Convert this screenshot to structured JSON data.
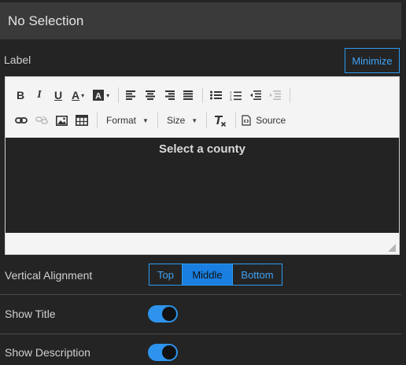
{
  "selection": {
    "text": "No Selection"
  },
  "label_section": {
    "label": "Label",
    "minimize_label": "Minimize"
  },
  "editor": {
    "toolbar": {
      "format_label": "Format",
      "size_label": "Size",
      "source_label": "Source"
    },
    "content": "Select a county"
  },
  "vertical_alignment": {
    "label": "Vertical Alignment",
    "options": [
      "Top",
      "Middle",
      "Bottom"
    ],
    "selected": "Middle"
  },
  "show_title": {
    "label": "Show Title",
    "enabled": true
  },
  "show_description": {
    "label": "Show Description",
    "enabled": true
  },
  "colors": {
    "accent": "#2d9bf0",
    "selected": "#1a7fe0",
    "background": "#242424"
  }
}
